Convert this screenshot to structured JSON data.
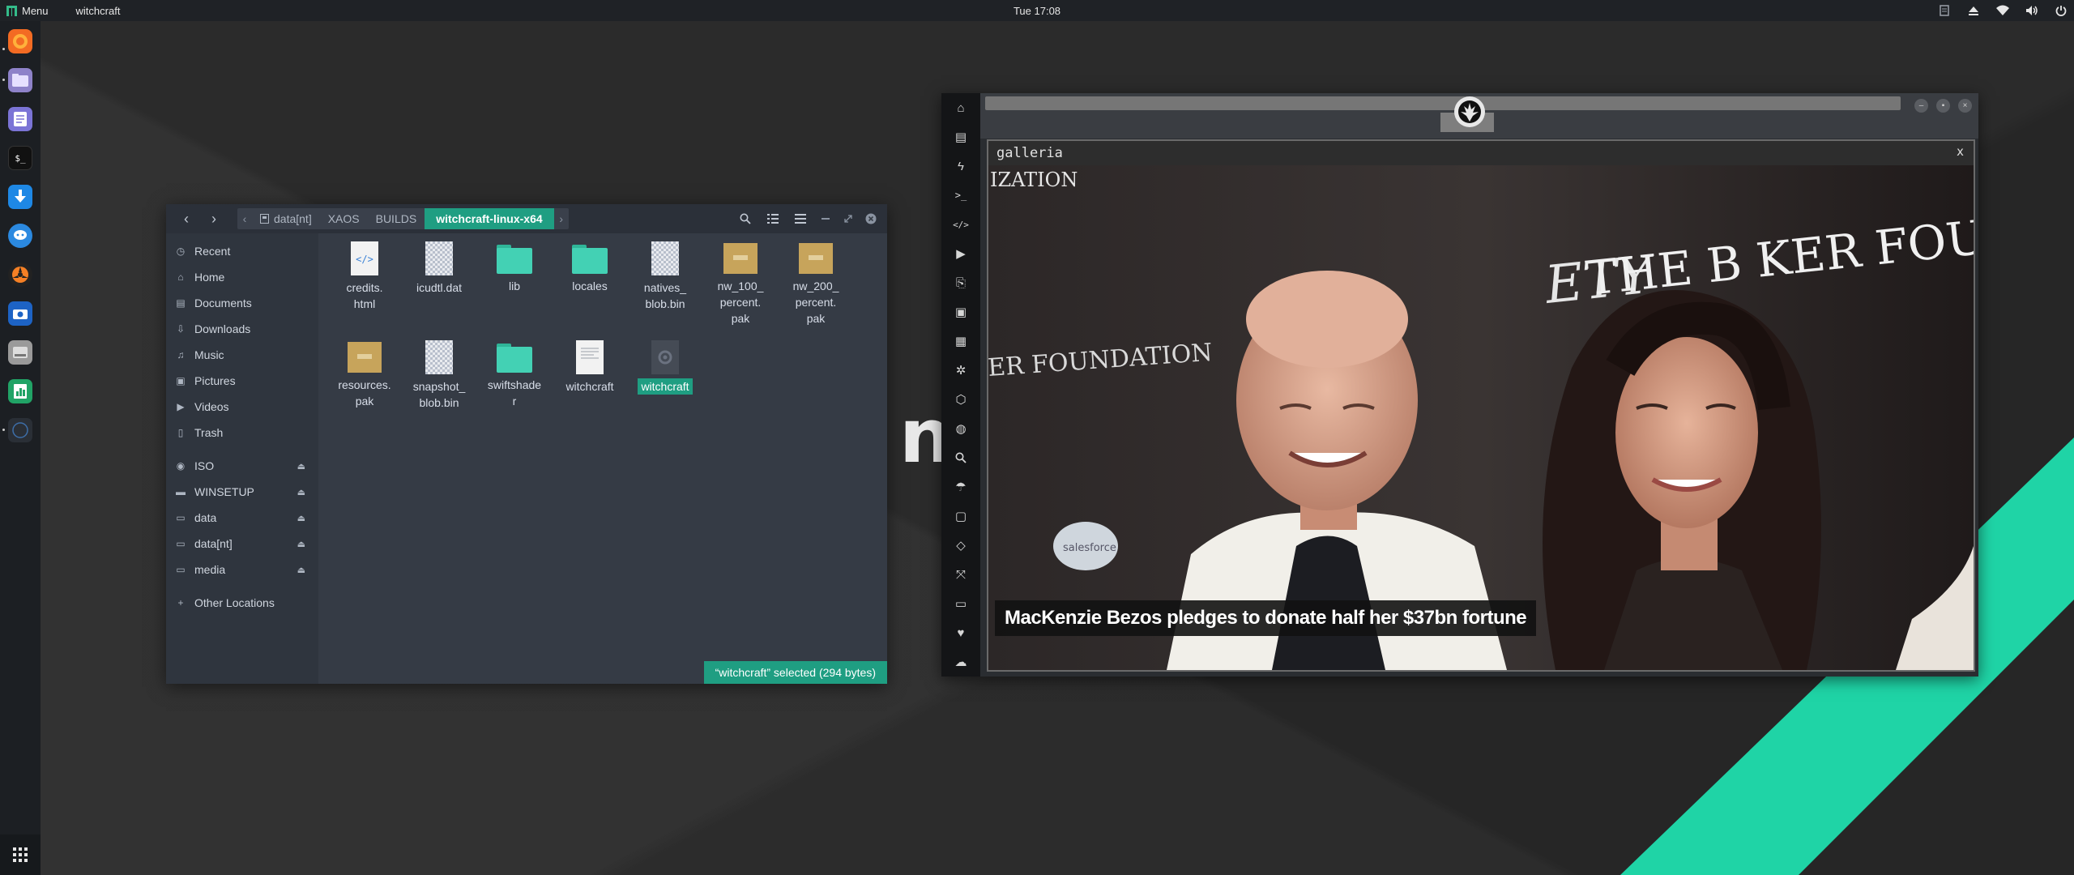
{
  "top_panel": {
    "menu_label": "Menu",
    "active_app": "witchcraft",
    "clock": "Tue 17:08"
  },
  "dock": {
    "items": [
      "firefox-icon",
      "files-icon",
      "text-editor-icon",
      "terminal-icon",
      "downloader-icon",
      "chat-icon",
      "media-player-icon",
      "screenshot-icon",
      "disks-icon",
      "spreadsheet-icon",
      "witchcraft-icon"
    ],
    "apps_grid": "apps-grid-icon"
  },
  "background": {
    "logo_text": "n"
  },
  "file_manager": {
    "breadcrumbs": [
      "data[nt]",
      "XAOS",
      "BUILDS",
      "witchcraft-linux-x64"
    ],
    "sidebar": {
      "places": [
        "Recent",
        "Home",
        "Documents",
        "Downloads",
        "Music",
        "Pictures",
        "Videos",
        "Trash"
      ],
      "devices": [
        "ISO",
        "WINSETUP",
        "data",
        "data[nt]",
        "media"
      ],
      "other": "Other Locations"
    },
    "files": [
      {
        "name": "credits.\nhtml",
        "kind": "html"
      },
      {
        "name": "icudtl.dat",
        "kind": "binary"
      },
      {
        "name": "lib",
        "kind": "folder"
      },
      {
        "name": "locales",
        "kind": "folder"
      },
      {
        "name": "natives_\nblob.bin",
        "kind": "binary"
      },
      {
        "name": "nw_100_\npercent.\npak",
        "kind": "pak"
      },
      {
        "name": "nw_200_\npercent.\npak",
        "kind": "pak"
      },
      {
        "name": "resources.\npak",
        "kind": "pak"
      },
      {
        "name": "snapshot_\nblob.bin",
        "kind": "binary"
      },
      {
        "name": "swiftshade\nr",
        "kind": "folder"
      },
      {
        "name": "witchcraft",
        "kind": "text"
      },
      {
        "name": "witchcraft",
        "kind": "executable",
        "selected": true
      }
    ],
    "status": "“witchcraft” selected  (294 bytes)"
  },
  "browser": {
    "gallery_title": "galleria",
    "gallery_close": "x",
    "caption": "MacKenzie Bezos pledges to donate half her $37bn fortune",
    "photo_text": {
      "top_left": "IZATION",
      "left_banner": "ER FOUNDATION",
      "center_logo": "ETY",
      "right_banner": "THE B   KER FOU",
      "sponsor": "salesforce"
    },
    "rail_icons": [
      "home-icon",
      "document-icon",
      "bolt-icon",
      "terminal-icon",
      "code-icon",
      "play-icon",
      "translate-icon",
      "image-icon",
      "news-icon",
      "react-icon",
      "hexagon-icon",
      "globe-icon",
      "search-icon",
      "umbrella-icon",
      "contact-icon",
      "diamond-icon",
      "expand-icon",
      "youtube-icon",
      "heart-icon",
      "cloud-icon"
    ]
  },
  "colors": {
    "accent": "#1f9e82",
    "folder": "#43d1b4",
    "panel": "#1f2226",
    "stripe": "#1fd4a6"
  }
}
